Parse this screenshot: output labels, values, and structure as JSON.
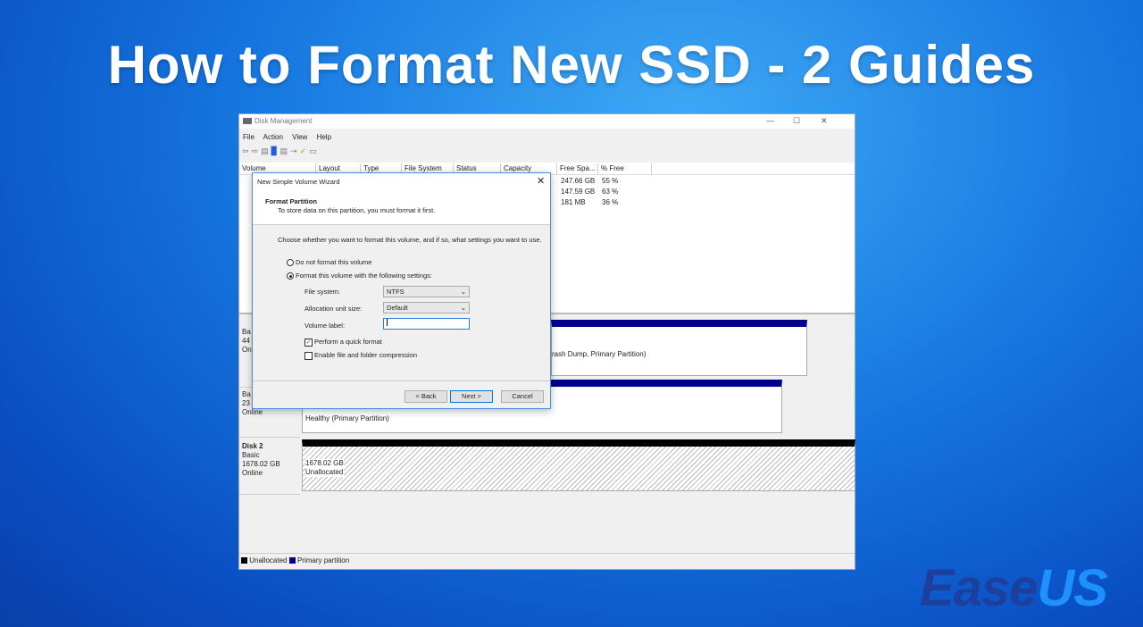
{
  "headline": "How to Format New SSD - 2 Guides",
  "window": {
    "title": "Disk Management",
    "controls": [
      "—",
      "☐",
      "✕"
    ],
    "menu": [
      "File",
      "Action",
      "View",
      "Help"
    ],
    "columns": [
      "Volume",
      "Layout",
      "Type",
      "File System",
      "Status",
      "Capacity",
      "Free Spa...",
      "% Free"
    ],
    "rows": [
      {
        "free": "247.66 GB",
        "pct": "55 %"
      },
      {
        "free": "147.59 GB",
        "pct": "63 %"
      },
      {
        "free": "181 MB",
        "pct": "36 %"
      }
    ],
    "disks": [
      {
        "lines": [
          "Ba",
          "44",
          "On"
        ],
        "part_text": "rash Dump, Primary Partition)"
      },
      {
        "lines": [
          "Ba",
          "23",
          "Online"
        ],
        "part_text": "Healthy (Primary Partition)"
      },
      {
        "lines": [
          "Disk 2",
          "Basic",
          "1678.02 GB",
          "Online"
        ],
        "part_text": [
          "1678.02 GB",
          "Unallocated"
        ]
      }
    ],
    "legend": [
      "Unallocated",
      "Primary partition"
    ],
    "colors": {
      "unallocated": "#000000",
      "primary": "#00008b"
    }
  },
  "dialog": {
    "title": "New Simple Volume Wizard",
    "heading": "Format Partition",
    "subheading": "To store data on this partition, you must format it first.",
    "prompt": "Choose whether you want to format this volume, and if so, what settings you want to use.",
    "radio_no": "Do not format this volume",
    "radio_yes": "Format this volume with the following settings:",
    "fs_label": "File system:",
    "fs_value": "NTFS",
    "alloc_label": "Allocation unit size:",
    "alloc_value": "Default",
    "vol_label": "Volume label:",
    "vol_value": "",
    "quick": "Perform a quick format",
    "compress": "Enable file and folder compression",
    "back": "< Back",
    "next": "Next >",
    "cancel": "Cancel"
  },
  "logo": {
    "part1": "Ease",
    "part2": "US"
  }
}
